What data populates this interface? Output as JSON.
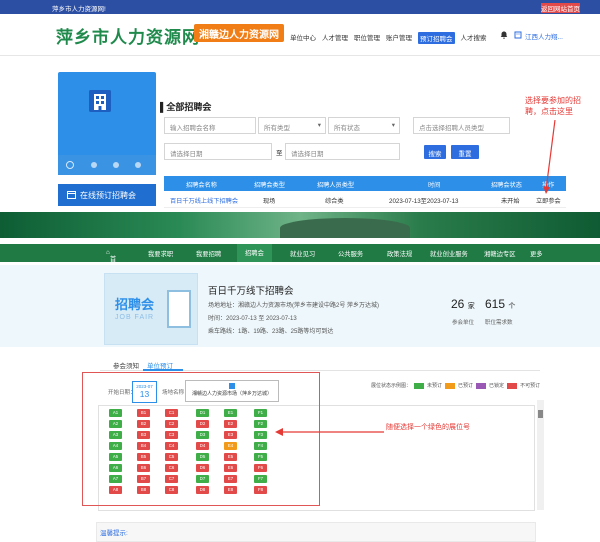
{
  "topbar": {
    "welcome": "萍乡市人力资源网!",
    "back_home": "返回网站首页"
  },
  "header": {
    "logo_text": "萍乡市人力资源网",
    "logo_badge": "湘赣边人力资源网",
    "nav": [
      "单位中心",
      "人才管理",
      "职位管理",
      "账户管理",
      "预订招聘会",
      "人才搜索"
    ],
    "active_nav_index": 4,
    "user_name": "江西人力翔..."
  },
  "sidebar": {
    "menu_label": "在线预订招聘会"
  },
  "section": {
    "title": "全部招聘会",
    "search_name_placeholder": "输入招聘会名称",
    "type_select": "所有类型",
    "status_select": "所有状态",
    "org_placeholder": "点击选择招聘人员类型",
    "start_date_placeholder": "请选择日期",
    "to": "至",
    "end_date_placeholder": "请选择日期",
    "search_button": "搜索",
    "reset_button": "重置"
  },
  "table": {
    "headers": [
      "招聘会名称",
      "招聘会类型",
      "招聘人员类型",
      "时间",
      "招聘会状态",
      "操作"
    ],
    "row": {
      "name": "百日千万线上线下招聘会",
      "type": "现场",
      "people_type": "综合类",
      "time": "2023-07-13至2023-07-13",
      "status": "未开始",
      "action": "立即参会"
    }
  },
  "callouts": {
    "select_fair": "选择要参加的招聘，点击这里",
    "select_booth": "随便选择一个绿色的展位号"
  },
  "green_nav": [
    "首页",
    "我要求职",
    "我要招聘",
    "招聘会",
    "就业见习",
    "公共服务",
    "政策法规",
    "就业创业服务",
    "湘赣边专区",
    "更多"
  ],
  "green_nav_active_index": 3,
  "fair": {
    "image_title": "招聘会",
    "image_sub": "JOB FAIR",
    "title": "百日千万线下招聘会",
    "venue": "场地地址：湘赣边人力资源市场(萍乡市建设中路2号 萍乡万达城)",
    "time": "时间：2023-07-13 至 2023-07-13",
    "route": "乘车路线：1路、19路、23路、25路等均可到达",
    "stat1_num": "26",
    "stat1_unit": "家",
    "stat1_label": "参会单位",
    "stat2_num": "615",
    "stat2_unit": "个",
    "stat2_label": "职位需求数"
  },
  "tabs": {
    "tab1": "参会须知",
    "tab2": "单位预订"
  },
  "booking": {
    "date_label": "开始日期：",
    "date_month": "2023-07",
    "date_day": "13",
    "venue_label": "场地名称：",
    "venue_value": "湘赣边人力资源市场（萍乡万达城）",
    "legend_label": "展位状态示例图：",
    "legend": [
      {
        "label": "未预订",
        "color": "#3fae49"
      },
      {
        "label": "已预订",
        "color": "#f29a1a"
      },
      {
        "label": "已锁定",
        "color": "#9b59b6"
      },
      {
        "label": "不可预订",
        "color": "#e24a4a"
      }
    ],
    "columns": [
      {
        "ids": [
          "A1",
          "A2",
          "A3",
          "A4",
          "A5",
          "A6",
          "A7",
          "A8"
        ],
        "status": [
          "g",
          "g",
          "g",
          "g",
          "g",
          "g",
          "g",
          "r"
        ]
      },
      {
        "ids": [
          "B1",
          "B2",
          "B3",
          "B4",
          "B5",
          "B6",
          "B7",
          "B8"
        ],
        "status": [
          "r",
          "r",
          "r",
          "r",
          "r",
          "r",
          "r",
          "r"
        ]
      },
      {
        "ids": [
          "C1",
          "C2",
          "C3",
          "C4",
          "C5",
          "C6",
          "C7",
          "C8"
        ],
        "status": [
          "r",
          "r",
          "r",
          "r",
          "r",
          "r",
          "r",
          "r"
        ]
      },
      {
        "ids": [
          "D1",
          "D2",
          "D3",
          "D4",
          "D5",
          "D6",
          "D7",
          "D8"
        ],
        "status": [
          "g",
          "r",
          "g",
          "r",
          "g",
          "r",
          "g",
          "r"
        ]
      },
      {
        "ids": [
          "E1",
          "E2",
          "E3",
          "E4",
          "E5",
          "E6",
          "E7",
          "E8"
        ],
        "status": [
          "g",
          "r",
          "r",
          "o",
          "r",
          "r",
          "r",
          "r"
        ]
      },
      {
        "ids": [
          "F1",
          "F2",
          "F3",
          "F4",
          "F5",
          "F6",
          "F7",
          "F8"
        ],
        "status": [
          "g",
          "g",
          "g",
          "g",
          "g",
          "r",
          "g",
          "r"
        ]
      }
    ],
    "warm_tip": "温馨提示:"
  },
  "colors": {
    "brand_blue": "#2d6de0",
    "brand_green": "#1f7a44",
    "available": "#3fae49",
    "booked": "#f29a1a",
    "unavailable": "#e24a4a",
    "callout": "#e53935"
  }
}
